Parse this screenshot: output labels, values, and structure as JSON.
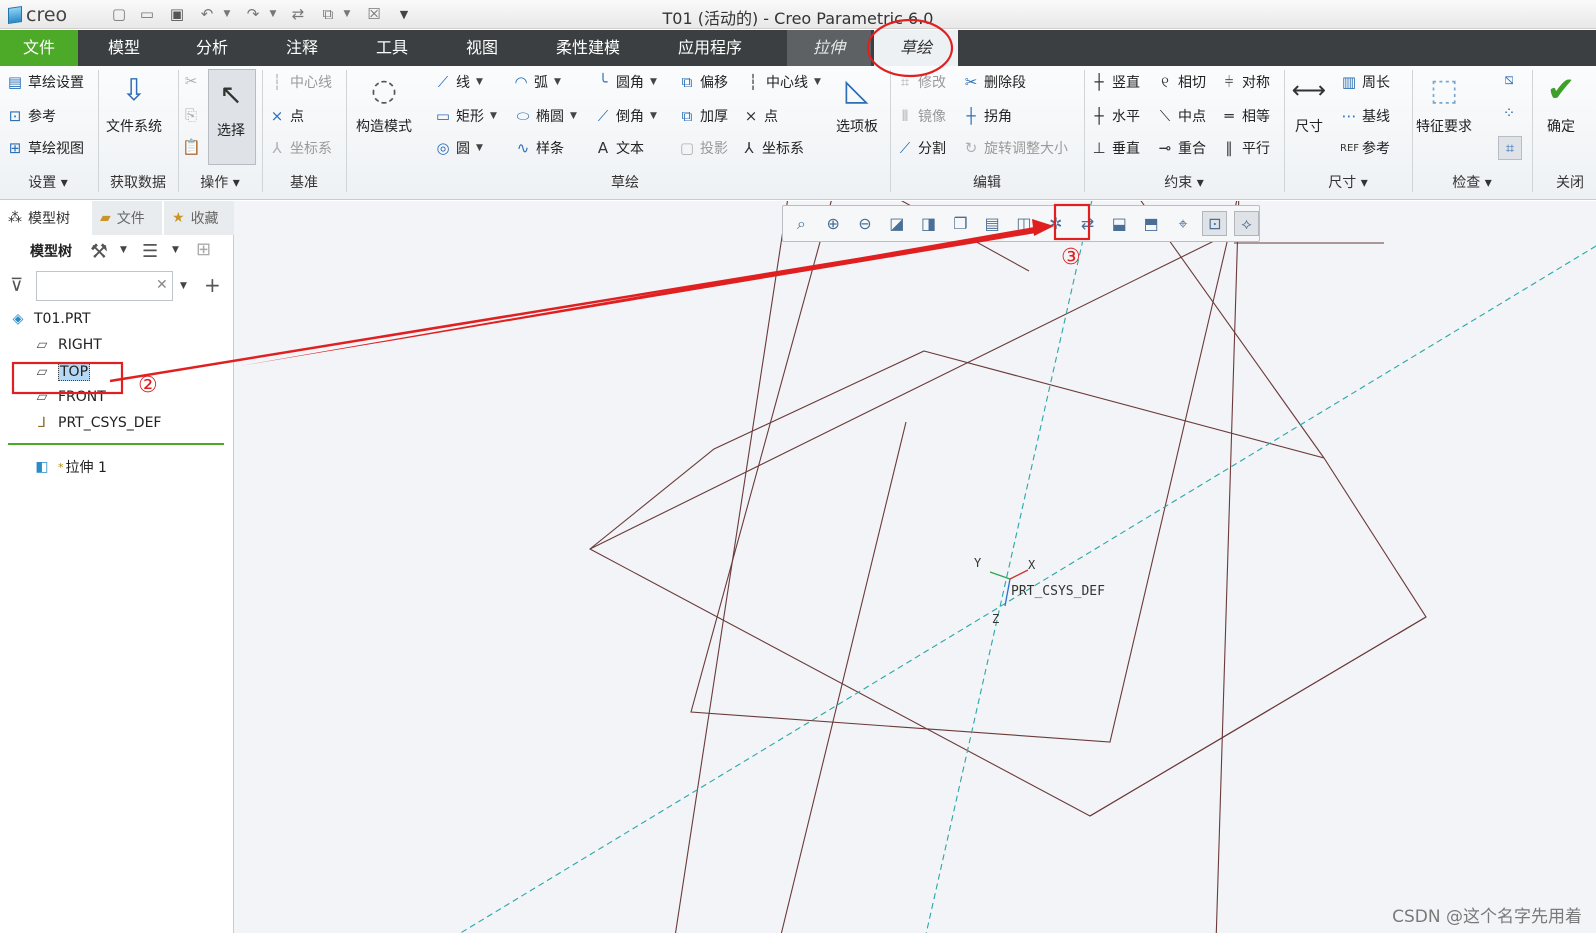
{
  "titlebar": {
    "logo": "creo",
    "title": "T01 (活动的) - Creo Parametric 6.0",
    "quick_icons": [
      "new-icon",
      "open-icon",
      "save-icon",
      "undo-icon",
      "redo-icon",
      "regenerate-icon",
      "windows-icon",
      "close-icon",
      "customize-icon"
    ]
  },
  "tabs": [
    "文件",
    "模型",
    "分析",
    "注释",
    "工具",
    "视图",
    "柔性建模",
    "应用程序",
    "拉伸",
    "草绘"
  ],
  "ribbon": {
    "setup": {
      "items": [
        "草绘设置",
        "参考",
        "草绘视图"
      ],
      "group": "设置"
    },
    "get_data": {
      "button": "文件系统",
      "group": "获取数据"
    },
    "operations": {
      "button": "选择",
      "group": "操作"
    },
    "datum": {
      "items": [
        "中心线",
        "点",
        "坐标系"
      ],
      "group": "基准"
    },
    "construct": {
      "button": "构造模式"
    },
    "sketch": {
      "items": [
        "线",
        "弧",
        "圆角",
        "偏移",
        "中心线",
        "矩形",
        "椭圆",
        "倒角",
        "加厚",
        "点",
        "圆",
        "样条",
        "文本",
        "投影",
        "坐标系"
      ],
      "palette": "选项板",
      "group": "草绘"
    },
    "edit": {
      "items": [
        "修改",
        "删除段",
        "镜像",
        "拐角",
        "分割",
        "旋转调整大小"
      ],
      "group": "编辑"
    },
    "constrain": {
      "items": [
        "竖直",
        "相切",
        "对称",
        "水平",
        "中点",
        "相等",
        "垂直",
        "重合",
        "平行"
      ],
      "group": "约束"
    },
    "dimension": {
      "button": "尺寸",
      "items": [
        "周长",
        "基线",
        "参考"
      ],
      "group": "尺寸"
    },
    "inspect": {
      "button": "特征要求",
      "group": "检查"
    },
    "close": {
      "button": "确定",
      "group": "关闭"
    }
  },
  "sidebar": {
    "tabs": [
      "模型树",
      "文件",
      "收藏"
    ],
    "toolbar_label": "模型树",
    "filter_placeholder": "",
    "tree": [
      {
        "label": "T01.PRT"
      },
      {
        "label": "RIGHT"
      },
      {
        "label": "TOP"
      },
      {
        "label": "FRONT"
      },
      {
        "label": "PRT_CSYS_DEF"
      },
      {
        "label": "拉伸 1"
      }
    ]
  },
  "canvas": {
    "csys_label": "PRT_CSYS_DEF",
    "axes": {
      "x": "X",
      "y": "Y",
      "z": "Z"
    },
    "view_icons": [
      "refit-icon",
      "zoom-in-icon",
      "zoom-out-icon",
      "repaint-icon",
      "display-style-icon",
      "saved-orientations-icon",
      "view-manager-icon",
      "perspective-icon",
      "annotation-display-icon",
      "sketch-view-icon",
      "shade-icon",
      "wireframe-icon",
      "spin-center-icon",
      "datum-display-icon",
      "sketcher-display-icon"
    ]
  },
  "annotations": {
    "step2": "②",
    "step3": "③"
  },
  "watermark": "CSDN @这个名字先用着",
  "colors": {
    "file_tab": "#4daa29",
    "tab_bar": "#3c3f41",
    "highlight": "#e02020",
    "csys_axis": "#2aa7a7",
    "datum_plane": "#6b3a3a"
  }
}
